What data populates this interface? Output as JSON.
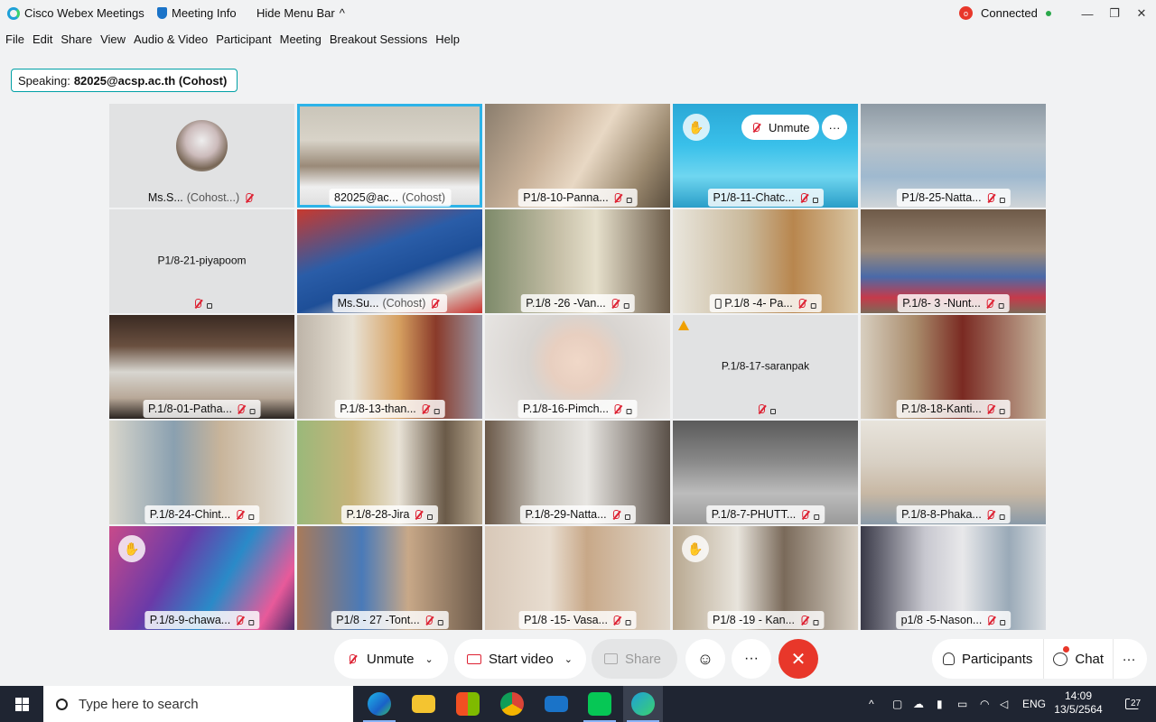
{
  "titlebar": {
    "app_name": "Cisco Webex Meetings",
    "meeting_info": "Meeting Info",
    "hide_menu_bar": "Hide Menu Bar",
    "status": "Connected",
    "recording_badge": "o"
  },
  "menu": [
    "File",
    "Edit",
    "Share",
    "View",
    "Audio & Video",
    "Participant",
    "Meeting",
    "Breakout Sessions",
    "Help"
  ],
  "speaking": {
    "label": "Speaking:",
    "name": "82025@acsp.ac.th (Cohost)"
  },
  "tiles": [
    {
      "name": "Ms.S...",
      "role": "(Cohost...)"
    },
    {
      "name": "82025@ac...",
      "role": "(Cohost)"
    },
    {
      "name": "P1/8-10-Panna..."
    },
    {
      "name": "P1/8-11-Chatc...",
      "unmute": "Unmute"
    },
    {
      "name": "P1/8-25-Natta..."
    },
    {
      "name": "P1/8-21-piyapoom"
    },
    {
      "name": "Ms.Su...",
      "role": "(Cohost)"
    },
    {
      "name": "P.1/8 -26 -Van..."
    },
    {
      "name": "P.1/8 -4- Pa..."
    },
    {
      "name": "P.1/8- 3 -Nunt..."
    },
    {
      "name": "P.1/8-01-Patha..."
    },
    {
      "name": "P.1/8-13-than..."
    },
    {
      "name": "P.1/8-16-Pimch..."
    },
    {
      "name": "P.1/8-17-saranpak"
    },
    {
      "name": "P.1/8-18-Kanti..."
    },
    {
      "name": "P.1/8-24-Chint..."
    },
    {
      "name": "P.1/8-28-Jira"
    },
    {
      "name": "P.1/8-29-Natta..."
    },
    {
      "name": "P.1/8-7-PHUTT..."
    },
    {
      "name": "P.1/8-8-Phaka..."
    },
    {
      "name": "P.1/8-9-chawa..."
    },
    {
      "name": "P1/8 - 27 -Tont..."
    },
    {
      "name": "P1/8 -15- Vasa..."
    },
    {
      "name": "P1/8 -19 - Kan..."
    },
    {
      "name": "p1/8 -5-Nason..."
    }
  ],
  "controls": {
    "unmute": "Unmute",
    "start_video": "Start video",
    "share": "Share",
    "participants": "Participants",
    "chat": "Chat"
  },
  "taskbar": {
    "search_placeholder": "Type here to search",
    "lang": "ENG",
    "time": "14:09",
    "date": "13/5/2564",
    "notifications": "27"
  }
}
